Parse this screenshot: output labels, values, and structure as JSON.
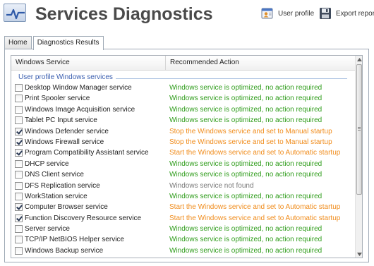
{
  "header": {
    "title": "Services Diagnostics",
    "logo_icon": "pulse-monitor-icon",
    "user_profile_label": "User profile",
    "export_report_label": "Export report"
  },
  "tabs": [
    {
      "label": "Home",
      "active": false
    },
    {
      "label": "Diagnostics Results",
      "active": true
    }
  ],
  "table": {
    "columns": [
      "Windows Service",
      "Recommended Action"
    ],
    "group_label": "User profile Windows services",
    "rows": [
      {
        "service": "Desktop Window Manager service",
        "checked": false,
        "action": "Windows service is optimized, no action required",
        "status": "ok"
      },
      {
        "service": "Print Spooler service",
        "checked": false,
        "action": "Windows service is optimized, no action required",
        "status": "ok"
      },
      {
        "service": "Windows Image Acquisition service",
        "checked": false,
        "action": "Windows service is optimized, no action required",
        "status": "ok"
      },
      {
        "service": "Tablet PC Input service",
        "checked": false,
        "action": "Windows service is optimized, no action required",
        "status": "ok"
      },
      {
        "service": "Windows Defender service",
        "checked": true,
        "action": "Stop the Windows service and set to Manual startup",
        "status": "warn"
      },
      {
        "service": "Windows Firewall service",
        "checked": true,
        "action": "Stop the Windows service and set to Manual startup",
        "status": "warn"
      },
      {
        "service": "Program Compatibility Assistant service",
        "checked": true,
        "action": "Start the Windows service and set to Automatic startup",
        "status": "warn"
      },
      {
        "service": "DHCP service",
        "checked": false,
        "action": "Windows service is optimized, no action required",
        "status": "ok"
      },
      {
        "service": "DNS Client service",
        "checked": false,
        "action": "Windows service is optimized, no action required",
        "status": "ok"
      },
      {
        "service": "DFS Replication service",
        "checked": false,
        "action": "Windows service not found",
        "status": "missing"
      },
      {
        "service": "WorkStation service",
        "checked": false,
        "action": "Windows service is optimized, no action required",
        "status": "ok"
      },
      {
        "service": "Computer Browser service",
        "checked": true,
        "action": "Start the Windows service and set to Automatic startup",
        "status": "warn"
      },
      {
        "service": "Function Discovery Resource service",
        "checked": true,
        "action": "Start the Windows service and set to Automatic startup",
        "status": "warn"
      },
      {
        "service": "Server service",
        "checked": false,
        "action": "Windows service is optimized, no action required",
        "status": "ok"
      },
      {
        "service": "TCP/IP NetBIOS Helper service",
        "checked": false,
        "action": "Windows service is optimized, no action required",
        "status": "ok"
      },
      {
        "service": "Windows Backup service",
        "checked": false,
        "action": "Windows service is optimized, no action required",
        "status": "ok"
      }
    ]
  },
  "colors": {
    "ok": "#2e9c1a",
    "warn": "#f08c1c",
    "missing": "#7a7a7a",
    "group": "#3b5fb0",
    "title": "#4a4a4a"
  }
}
